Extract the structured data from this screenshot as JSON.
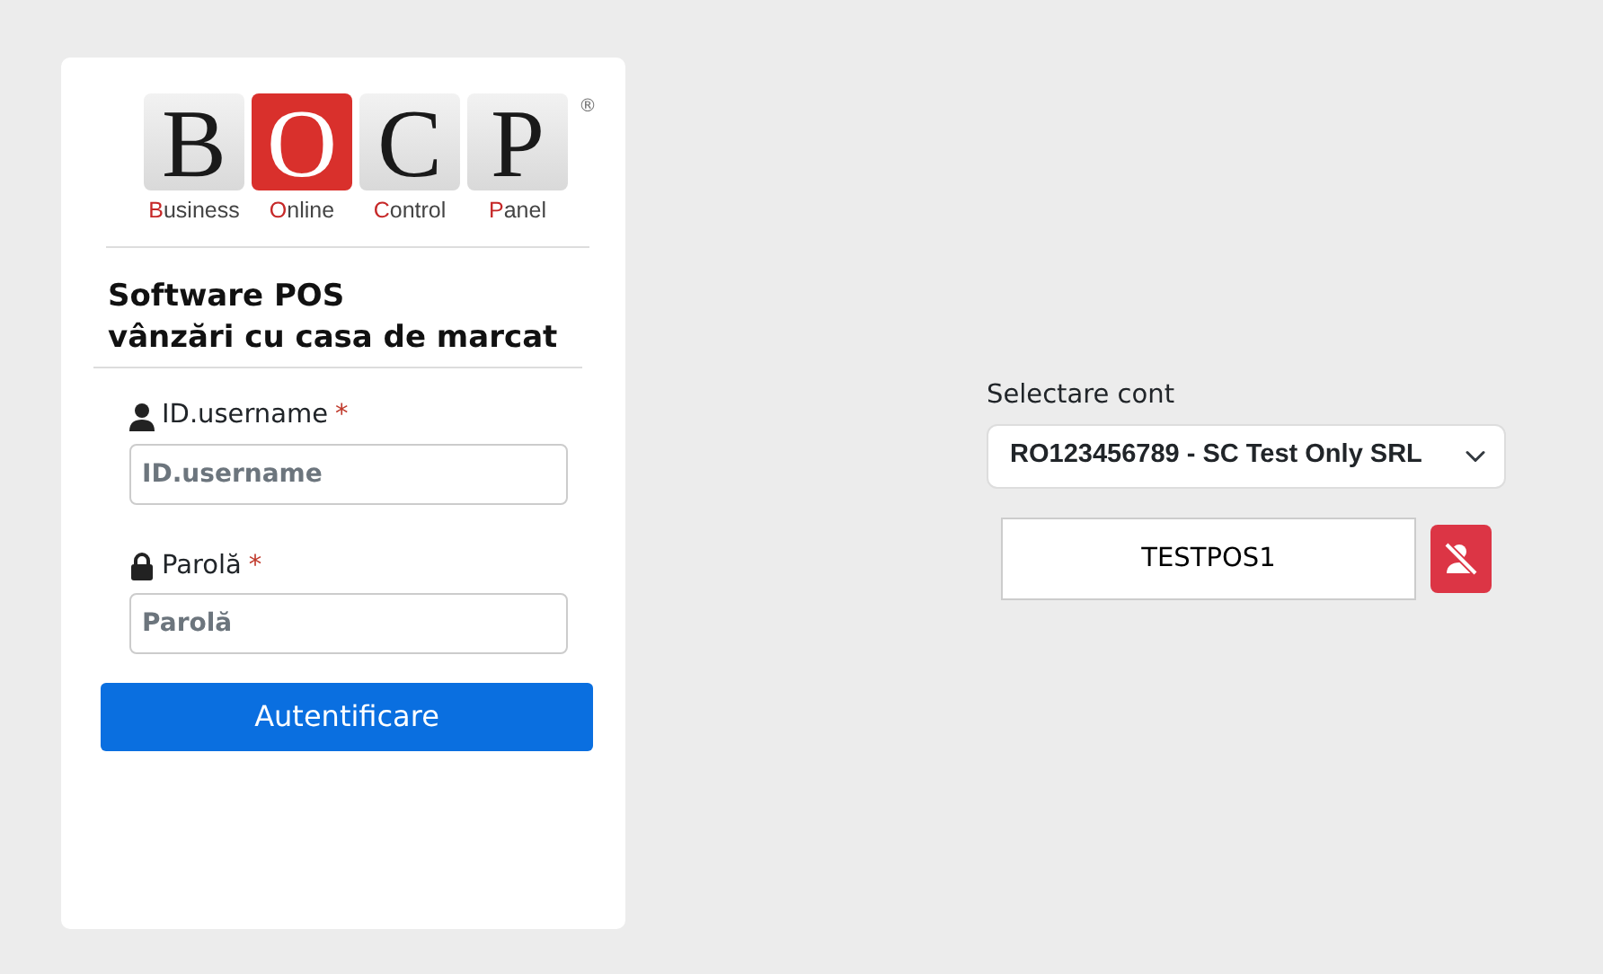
{
  "logo": {
    "tiles": [
      {
        "letter": "B",
        "word": "Business",
        "accent": false
      },
      {
        "letter": "O",
        "word": "Online",
        "accent": true
      },
      {
        "letter": "C",
        "word": "Control",
        "accent": false
      },
      {
        "letter": "P",
        "word": "Panel",
        "accent": false
      }
    ],
    "registered": "®"
  },
  "heading": [
    "Software POS",
    "vânzări cu casa de marcat"
  ],
  "login_fields": [
    {
      "kind": "user",
      "label": "ID.username",
      "required": "*",
      "placeholder": "ID.username"
    },
    {
      "kind": "lock",
      "label": "Parolă",
      "required": "*",
      "placeholder": "Parolă"
    }
  ],
  "login_button": "Autentificare",
  "account": {
    "label": "Selectare cont",
    "value": "RO123456789 - SC Test Only SRL"
  },
  "terminal": {
    "value": "TESTPOS1"
  }
}
